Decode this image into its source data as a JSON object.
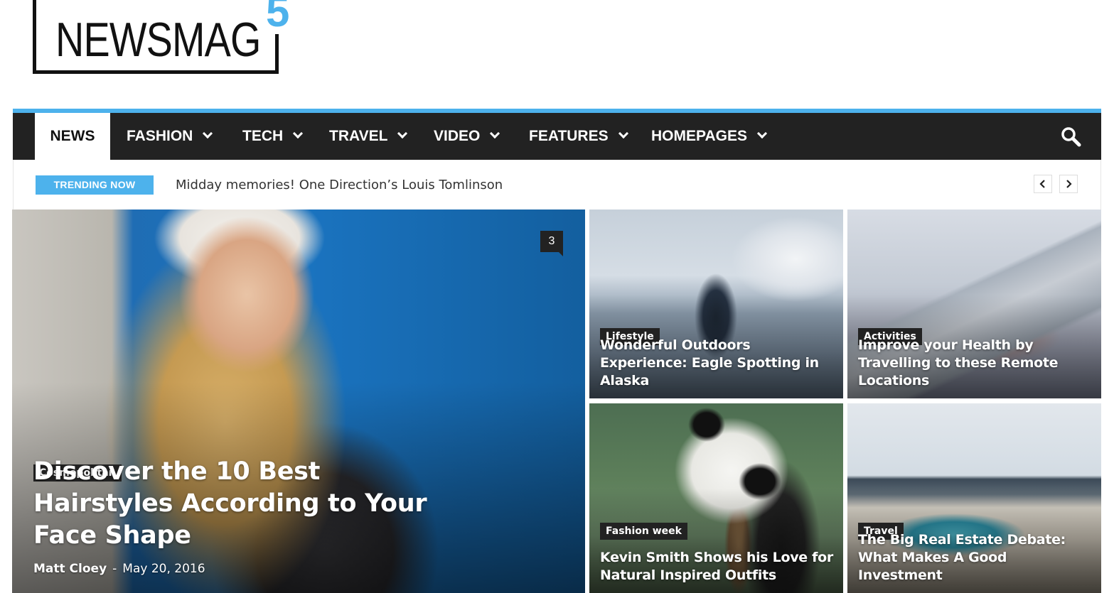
{
  "logo": {
    "text": "NEWSMAG",
    "version": "5",
    "accent": "#4db2ec"
  },
  "nav": {
    "items": [
      {
        "label": "NEWS",
        "dropdown": false
      },
      {
        "label": "FASHION",
        "dropdown": true
      },
      {
        "label": "TECH",
        "dropdown": true
      },
      {
        "label": "TRAVEL",
        "dropdown": true
      },
      {
        "label": "VIDEO",
        "dropdown": true
      },
      {
        "label": "FEATURES",
        "dropdown": true
      },
      {
        "label": "HOMEPAGES",
        "dropdown": true
      }
    ],
    "search_icon": "search-icon",
    "background": "#222222"
  },
  "trending": {
    "label": "TRENDING NOW",
    "headline": "Midday memories! One Direction’s Louis Tomlinson",
    "prev_icon": "chevron-left-icon",
    "next_icon": "chevron-right-icon"
  },
  "featured": {
    "category": "Cosmopolitan",
    "title": "Discover the 10 Best Hairstyles According to Your Face Shape",
    "author": "Matt Cloey",
    "separator": "-",
    "date": "May 20, 2016",
    "comments": "3"
  },
  "tiles": [
    {
      "category": "Lifestyle",
      "title": "Wonderful Outdoors Experience: Eagle Spotting in Alaska"
    },
    {
      "category": "Activities",
      "title": "Improve your Health by Travelling to these Remote Locations"
    },
    {
      "category": "Fashion week",
      "title": "Kevin Smith Shows his Love for Natural Inspired Outfits"
    },
    {
      "category": "Travel",
      "title": "The Big Real Estate Debate: What Makes A Good Investment"
    }
  ]
}
